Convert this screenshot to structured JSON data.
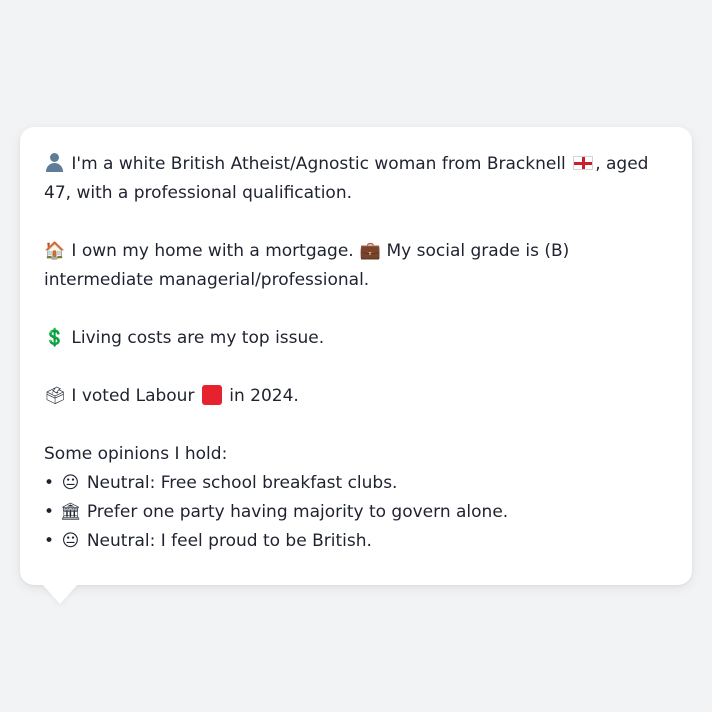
{
  "profile": {
    "intro_text": "I'm a white British Atheist/Agnostic woman from Bracknell",
    "intro_after_flag": ", aged 47, with a professional qualification.",
    "home_text": "I own my home with a mortgage.",
    "grade_text": "My social grade is (B) intermediate managerial/professional.",
    "issue_text": "Living costs are my top issue.",
    "vote_before": "I voted Labour",
    "vote_after": "in 2024."
  },
  "opinions": {
    "heading": "Some opinions I hold:",
    "items": [
      {
        "bullet": "•",
        "emoji": "😐",
        "text": "Neutral: Free school breakfast clubs."
      },
      {
        "bullet": "•",
        "emoji": "🏛",
        "text": "Prefer one party having majority to govern alone."
      },
      {
        "bullet": "•",
        "emoji": "😐",
        "text": "Neutral: I feel proud to be British."
      }
    ]
  },
  "icons": {
    "person": "person-silhouette-icon",
    "england_flag": "england-flag-icon",
    "house": "🏠",
    "briefcase": "💼",
    "dollar": "💲",
    "ballot_box": "🗳",
    "labour_square": "red-square-icon"
  },
  "colors": {
    "background": "#f2f3f5",
    "card": "#ffffff",
    "text": "#1f2330",
    "labour_red": "#e5222e"
  }
}
